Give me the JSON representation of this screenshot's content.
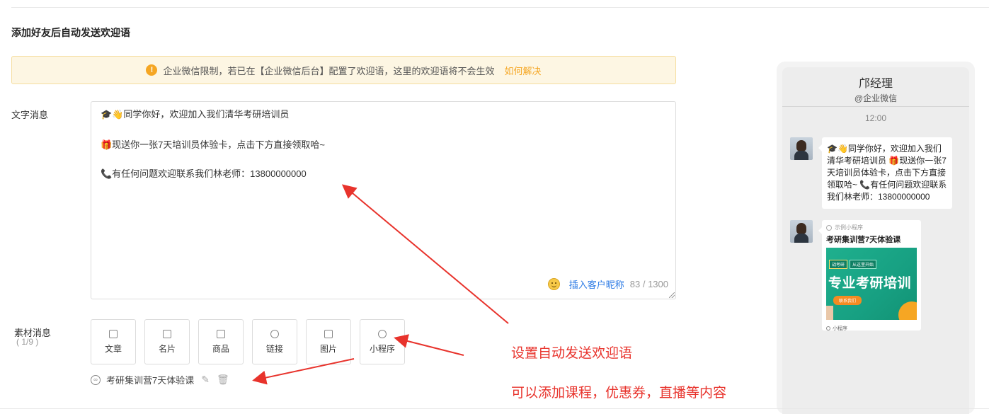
{
  "section_title": "添加好友后自动发送欢迎语",
  "notice": {
    "text": "企业微信限制，若已在【企业微信后台】配置了欢迎语，这里的欢迎语将不会生效",
    "link": "如何解决",
    "icon": "warning-icon",
    "accent_color": "#f5a623"
  },
  "text_message": {
    "label": "文字消息",
    "lines": [
      "🎓👋同学你好，欢迎加入我们清华考研培训员",
      "🎁现送你一张7天培训员体验卡，点击下方直接领取哈~",
      "📞有任何问题欢迎联系我们林老师：13800000000"
    ],
    "insert_nickname": "插入客户昵称",
    "counter": "83 / 1300",
    "link_color": "#2d7be5"
  },
  "material": {
    "label": "素材消息",
    "count": "( 1/9 )",
    "buttons": [
      {
        "label": "文章",
        "icon": "article-icon"
      },
      {
        "label": "名片",
        "icon": "card-icon"
      },
      {
        "label": "商品",
        "icon": "product-icon"
      },
      {
        "label": "链接",
        "icon": "link-icon"
      },
      {
        "label": "图片",
        "icon": "image-icon"
      },
      {
        "label": "小程序",
        "icon": "mini-program-icon"
      }
    ],
    "attached_item": "考研集训营7天体验课"
  },
  "annotations": {
    "line1": "设置自动发送欢迎语",
    "line2": "可以添加课程，优惠券，直播等内容",
    "color": "#e8332c"
  },
  "preview": {
    "contact_name": "邝经理",
    "contact_sub": "@企业微信",
    "time": "12:00",
    "bubble_text": "🎓👋同学你好，欢迎加入我们清华考研培训员 🎁现送你一张7天培训员体验卡，点击下方直接领取哈~ 📞有任何问题欢迎联系我们林老师：13800000000",
    "card": {
      "source": "示例小程序",
      "title": "考研集训营7天体验课",
      "tag1": "战考研",
      "tag2": "从这里开始",
      "image_headline": "专业考研培训",
      "cta": "联系我们",
      "footer": "小程序"
    }
  }
}
